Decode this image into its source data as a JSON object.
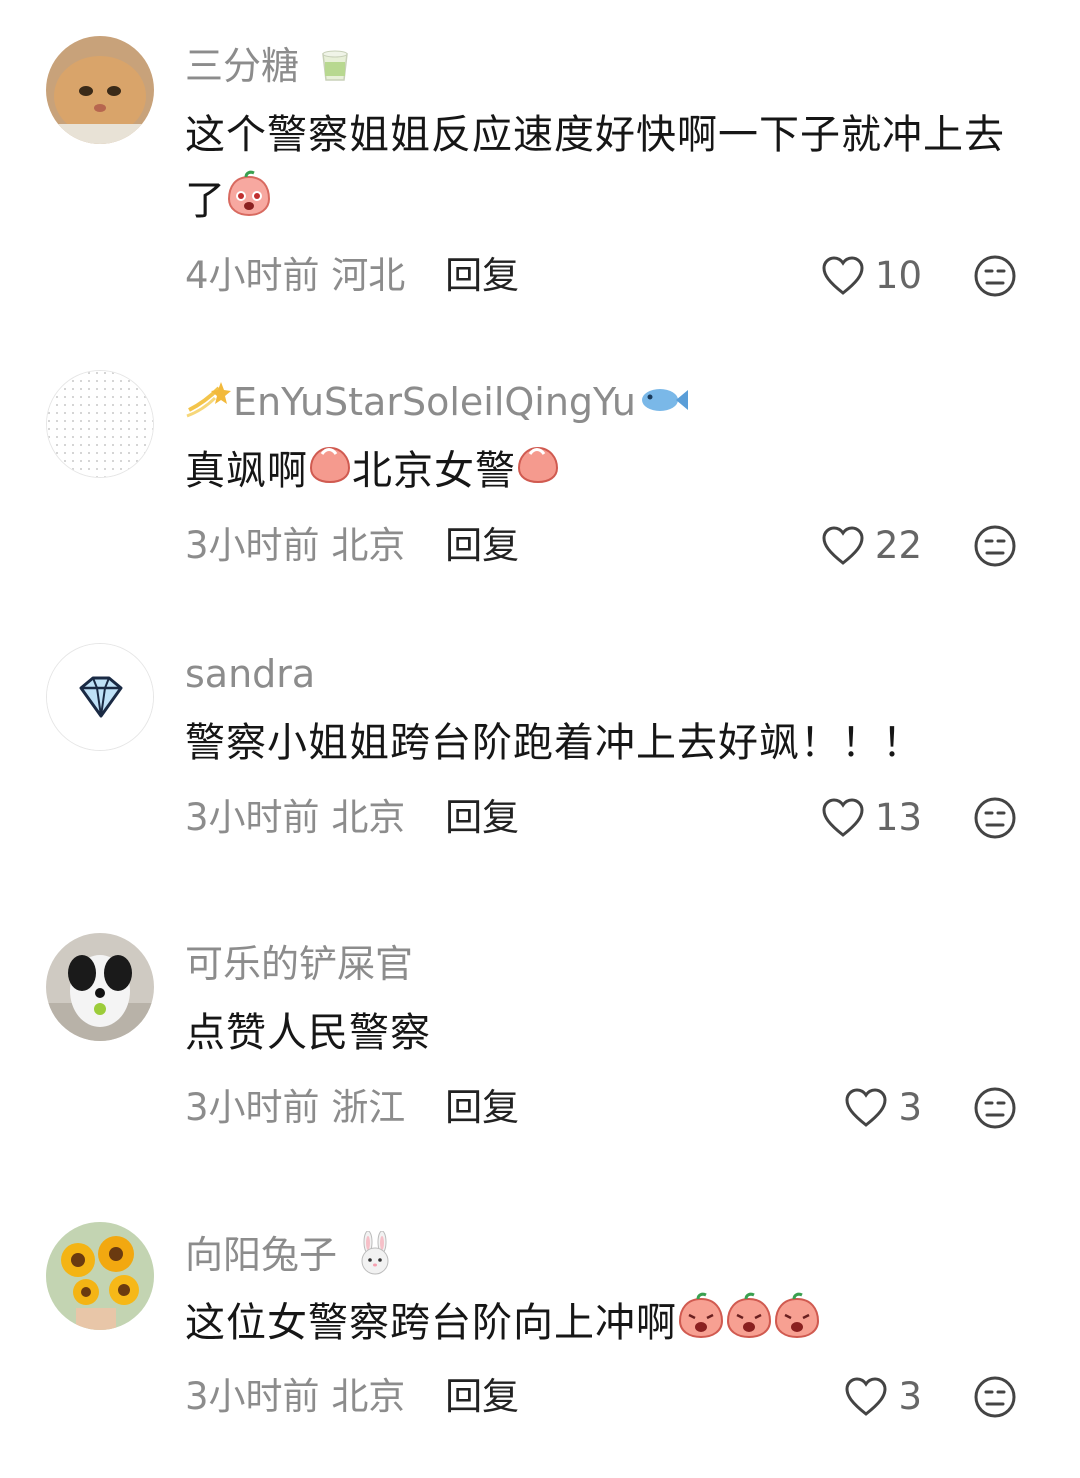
{
  "comments": [
    {
      "username": "三分糖",
      "text": "这个警察姐姐反应速度好快啊一下子就冲上去了",
      "time": "4小时前",
      "location": "河北",
      "reply_label": "回复",
      "likes": "10"
    },
    {
      "username": "EnYuStarSoleilQingYu",
      "text_a": "真飒啊",
      "text_b": "北京女警",
      "time": "3小时前",
      "location": "北京",
      "reply_label": "回复",
      "likes": "22"
    },
    {
      "username": "sandra",
      "text": "警察小姐姐跨台阶跑着冲上去好飒！！！",
      "time": "3小时前",
      "location": "北京",
      "reply_label": "回复",
      "likes": "13"
    },
    {
      "username": "可乐的铲屎官",
      "text": "点赞人民警察",
      "time": "3小时前",
      "location": "浙江",
      "reply_label": "回复",
      "likes": "3"
    },
    {
      "username": "向阳兔子",
      "text": "这位女警察跨台阶向上冲啊",
      "time": "3小时前",
      "location": "北京",
      "reply_label": "回复",
      "likes": "3"
    }
  ],
  "colors": {
    "secondary_text": "#8c8c8c",
    "primary_text": "#161616"
  },
  "icons": [
    "heart-icon",
    "dislike-face-icon",
    "tea-cup-emoji",
    "shooting-star-emoji",
    "fish-emoji",
    "rabbit-emoji",
    "peach-emoji"
  ]
}
